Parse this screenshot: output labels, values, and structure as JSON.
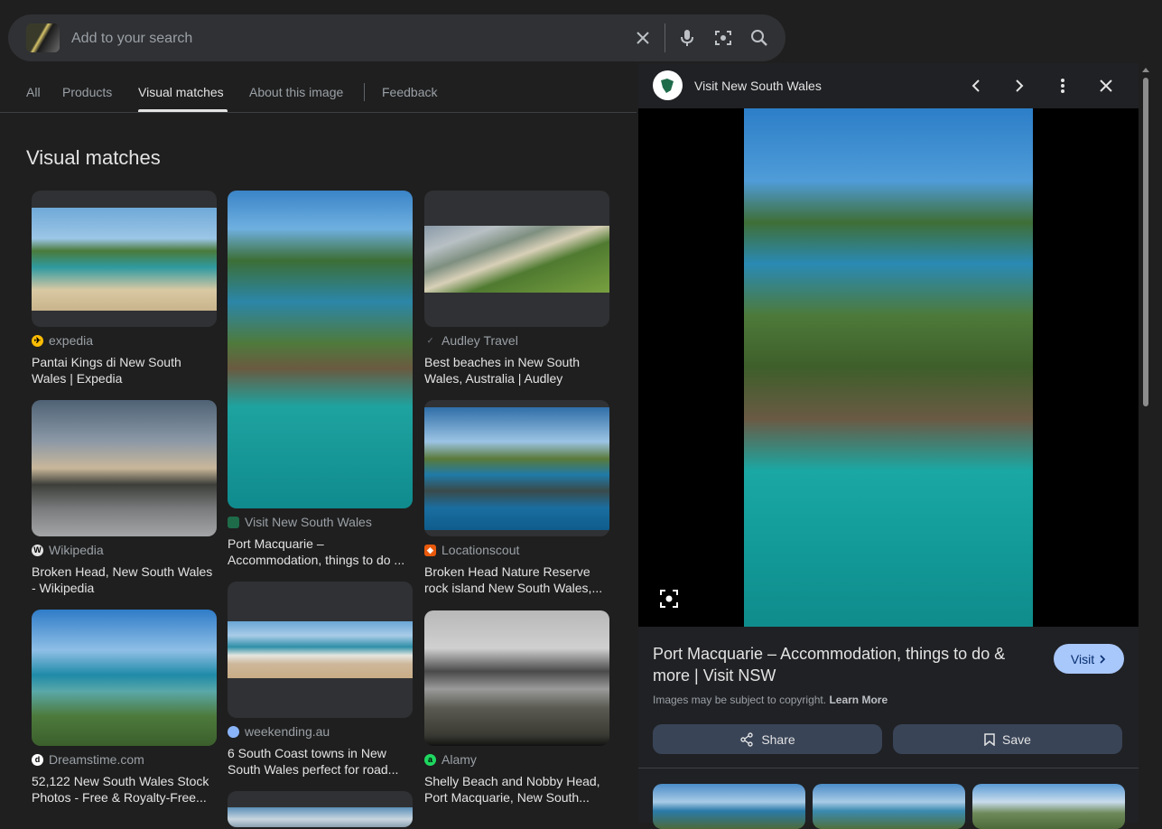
{
  "search": {
    "placeholder": "Add to your search"
  },
  "tabs": [
    {
      "label": "All"
    },
    {
      "label": "Products"
    },
    {
      "label": "Visual matches"
    },
    {
      "label": "About this image"
    },
    {
      "label": "Feedback"
    }
  ],
  "active_tab": "Visual matches",
  "section_heading": "Visual matches",
  "results": [
    {
      "source": "expedia",
      "title": "Pantai Kings di New South Wales | Expedia",
      "icon": "expedia-logo-icon"
    },
    {
      "source": "Visit New South Wales",
      "title": "Port Macquarie – Accommodation, things to do ...",
      "icon": "nsw-logo-icon"
    },
    {
      "source": "Audley Travel",
      "title": "Best beaches in New South Wales, Australia | Audley Travel...",
      "icon": "audley-logo-icon"
    },
    {
      "source": "Wikipedia",
      "title": "Broken Head, New South Wales - Wikipedia",
      "icon": "wikipedia-logo-icon"
    },
    {
      "source": "Locationscout",
      "title": "Broken Head Nature Reserve rock island New South Wales,...",
      "icon": "locationscout-logo-icon"
    },
    {
      "source": "weekending.au",
      "title": "6 South Coast towns in New South Wales perfect for road...",
      "icon": "weekending-logo-icon"
    },
    {
      "source": "Dreamstime.com",
      "title": "52,122 New South Wales Stock Photos - Free & Royalty-Free...",
      "icon": "dreamstime-logo-icon"
    },
    {
      "source": "Alamy",
      "title": "Shelly Beach and Nobby Head, Port Macquarie, New South...",
      "icon": "alamy-logo-icon"
    }
  ],
  "panel": {
    "site_name": "Visit New South Wales",
    "title": "Port Macquarie – Accommodation, things to do & more | Visit NSW",
    "visit_label": "Visit",
    "copyright_text": "Images may be subject to copyright.",
    "learn_more": "Learn More",
    "share_label": "Share",
    "save_label": "Save"
  },
  "colors": {
    "background": "#1f1f1f",
    "search_bg": "#303134",
    "visit_button": "#a8c7fa",
    "action_button": "#394457"
  }
}
